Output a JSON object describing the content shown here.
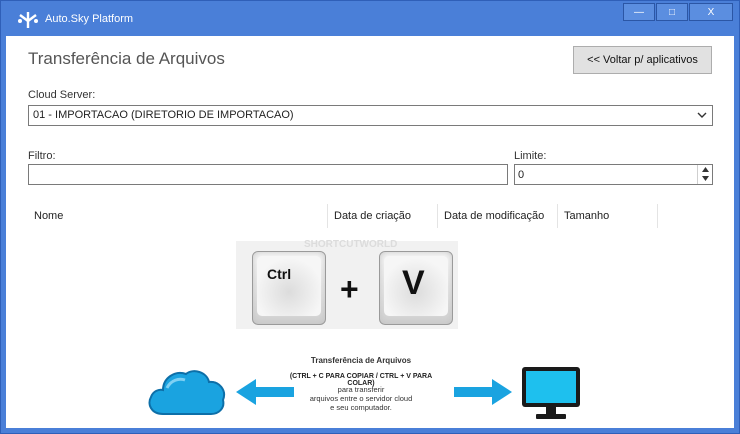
{
  "window": {
    "title": "Auto.Sky Platform",
    "controls": [
      "—",
      "□",
      "X"
    ]
  },
  "page": {
    "title": "Transferência de Arquivos",
    "back_button": "<< Voltar p/ aplicativos"
  },
  "cloud_server": {
    "label": "Cloud Server:",
    "selected": "01 - IMPORTACAO (DIRETORIO DE IMPORTACAO)"
  },
  "filter": {
    "label": "Filtro:",
    "value": ""
  },
  "limit": {
    "label": "Limite:",
    "value": "0"
  },
  "grid": {
    "columns": [
      "Nome",
      "Data de criação",
      "Data de modificação",
      "Tamanho"
    ]
  },
  "illustration": {
    "watermark": "SHORTCUTWORLD",
    "key_ctrl": "Ctrl",
    "plus": "+",
    "key_v": "V",
    "info_title": "Transferência de Arquivos",
    "info_sub": "(CTRL + C PARA COPIAR / CTRL + V PARA COLAR)",
    "info_desc": [
      "para transferir",
      "arquivos entre o servidor cloud",
      "e seu computador."
    ]
  },
  "colors": {
    "titlebar": "#4a7fd8",
    "accent": "#1aa3e0"
  },
  "icons": {
    "logo": "autosky-logo-icon",
    "dropdown": "chevron-down-icon",
    "cloud": "cloud-icon",
    "monitor": "monitor-icon"
  }
}
